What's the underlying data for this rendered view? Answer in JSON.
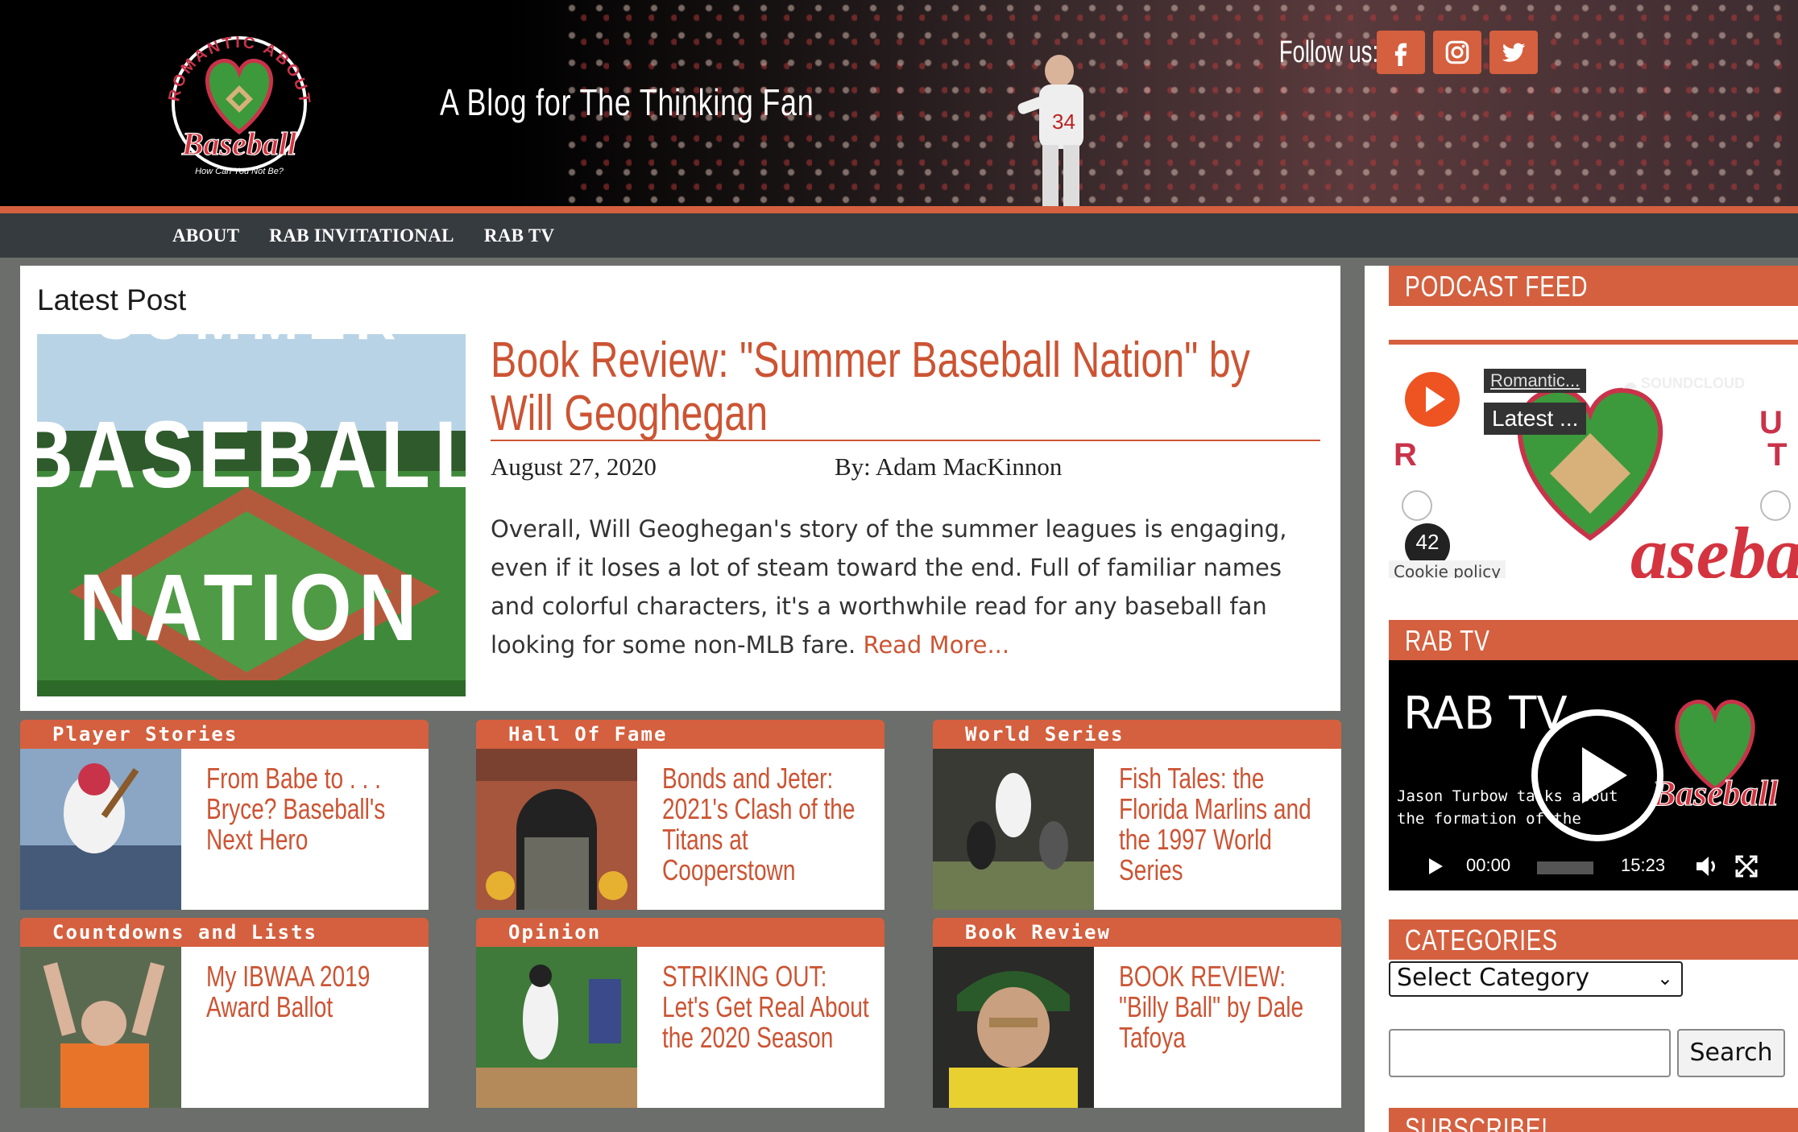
{
  "header": {
    "tagline": "A Blog for The Thinking Fan",
    "follow_label": "Follow us:",
    "logo_arc_text": "ROMANTIC ABOUT",
    "logo_word": "Baseball",
    "logo_sub": "How Can You Not Be?",
    "social": [
      {
        "icon": "facebook-icon"
      },
      {
        "icon": "instagram-icon"
      },
      {
        "icon": "twitter-icon"
      }
    ]
  },
  "nav": {
    "items": [
      "ABOUT",
      "RAB INVITATIONAL",
      "RAB TV"
    ]
  },
  "latest": {
    "heading": "Latest Post",
    "thumb_top": "SUMMER",
    "thumb_line1": "BASEBALL",
    "thumb_line2": "NATION",
    "title": "Book Review: \"Summer Baseball Nation\" by Will Geoghegan",
    "date": "August 27, 2020",
    "author": "By: Adam MacKinnon",
    "excerpt": "Overall, Will Geoghegan's story of the summer leagues is engaging, even if it loses a lot of steam toward the end. Full of familiar names and colorful characters, it's a worthwhile read for any baseball fan looking for some non-MLB fare.",
    "read_more": "Read More..."
  },
  "cards": [
    {
      "category": "Player Stories",
      "title": "From Babe to . . . Bryce? Baseball's Next Hero"
    },
    {
      "category": "Hall Of Fame",
      "title": "Bonds and Jeter: 2021's Clash of the Titans at Cooperstown"
    },
    {
      "category": "World Series",
      "title": "Fish Tales: the Florida Marlins and the 1997 World Series"
    },
    {
      "category": "Countdowns and Lists",
      "title": "My IBWAA 2019 Award Ballot"
    },
    {
      "category": "Opinion",
      "title": "STRIKING OUT: Let's Get Real About the 2020 Season"
    },
    {
      "category": "Book Review",
      "title": "BOOK REVIEW: \"Billy Ball\" by Dale Tafoya"
    }
  ],
  "sidebar": {
    "podcast_heading": "PODCAST FEED",
    "podcast_show": "Romantic...",
    "podcast_episode": "Latest ...",
    "podcast_count": "42",
    "podcast_brand": "SOUNDCLOUD",
    "cookie": "Cookie policy",
    "rabtv_heading": "RAB TV",
    "video_title": "RAB TV",
    "video_desc": "Jason Turbow talks about the formation of the",
    "time_current": "00:00",
    "time_duration": "15:23",
    "categories_heading": "CATEGORIES",
    "category_select": "Select Category",
    "search_button": "Search",
    "subscribe_heading": "SUBSCRIBE!"
  }
}
